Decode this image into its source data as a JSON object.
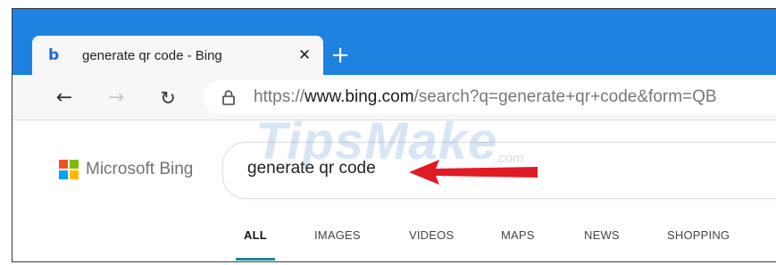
{
  "browser": {
    "tab": {
      "favicon": "b",
      "title": "generate qr code - Bing",
      "close_label": "✕"
    },
    "new_tab_label": "+",
    "toolbar": {
      "back_icon": "←",
      "forward_icon": "→",
      "refresh_icon": "↻",
      "url_prefix": "https://",
      "url_host": "www.bing.com",
      "url_path": "/search?q=generate+qr+code&form=QB"
    }
  },
  "page": {
    "logo_text": "Microsoft Bing",
    "search_query": "generate qr code",
    "scopes": [
      "ALL",
      "IMAGES",
      "VIDEOS",
      "MAPS",
      "NEWS",
      "SHOPPING"
    ],
    "active_scope": "ALL"
  },
  "watermark": {
    "main": "TipsMake",
    "suffix": ".com"
  },
  "colors": {
    "tabstrip": "#1d82e0",
    "arrow": "#e01b24",
    "scope_underline": "#1b8a8f"
  }
}
